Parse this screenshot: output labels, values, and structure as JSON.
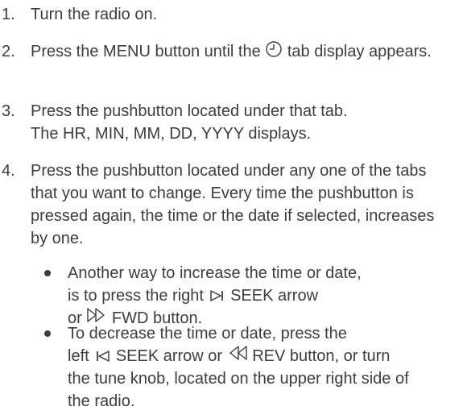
{
  "steps": [
    {
      "number": "1.",
      "text": "Turn the radio on."
    },
    {
      "number": "2.",
      "text_before": "Press the MENU button until the",
      "icon": "clock-icon",
      "text_after": "tab display appears."
    },
    {
      "number": "3.",
      "line1": "Press the pushbutton located under that tab.",
      "line2": "The HR, MIN, MM, DD, YYYY displays."
    },
    {
      "number": "4.",
      "text": "Press the pushbutton located under any one of the tabs that you want to change. Every time the pushbutton is pressed again, the time or the date if selected, increases by one."
    }
  ],
  "bullets": [
    {
      "line1": "Another way to increase the time or date,",
      "line2_before": "is to press the right",
      "seek_right_icon": "seek-right-icon",
      "line2_after": "SEEK arrow",
      "line3_before": "or",
      "fwd_icon": "fast-forward-icon",
      "line3_after": "FWD button."
    },
    {
      "line1": "To decrease the time or date, press the",
      "line2_before": "left",
      "seek_left_icon": "seek-left-icon",
      "line2_mid": "SEEK arrow or",
      "rev_icon": "rewind-icon",
      "line2_after": "REV button, or turn",
      "line3": "the tune knob, located on the upper right side of",
      "line4": "the radio."
    }
  ],
  "colors": {
    "text": "#3d3d3d"
  }
}
